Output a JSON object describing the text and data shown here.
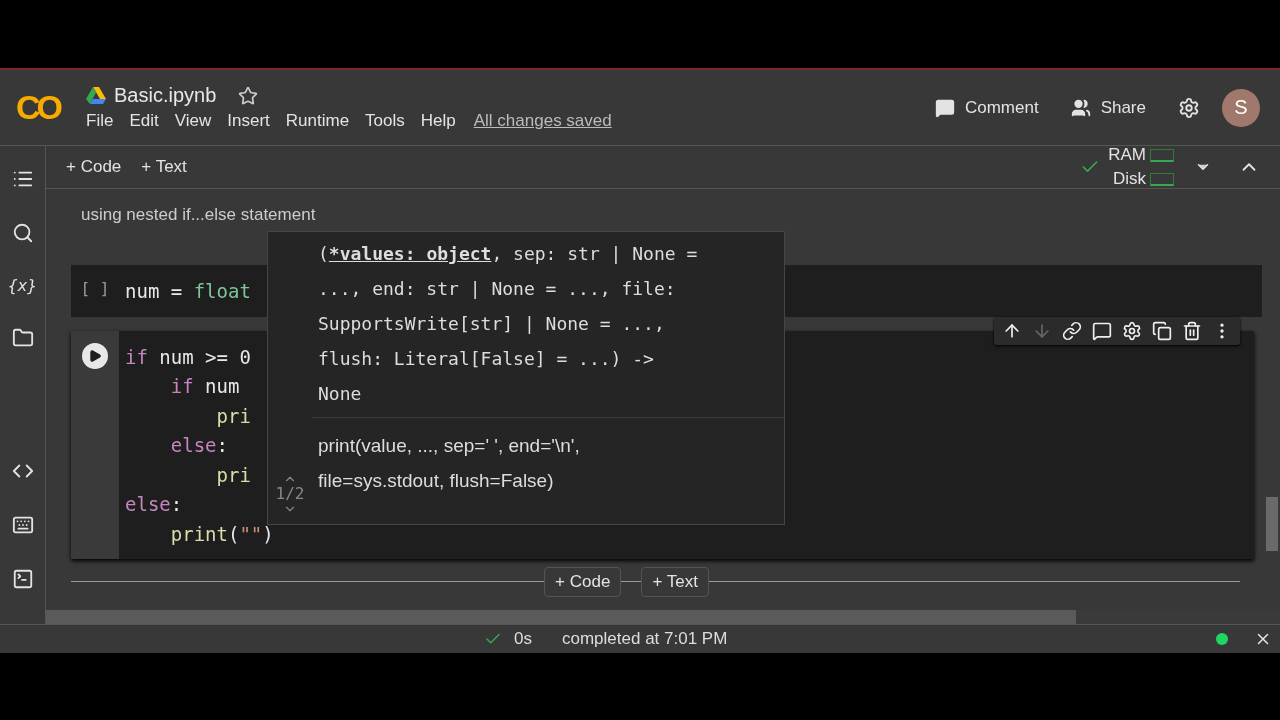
{
  "header": {
    "logo": "CO",
    "title": "Basic.ipynb",
    "starred": false,
    "menu": [
      "File",
      "Edit",
      "View",
      "Insert",
      "Runtime",
      "Tools",
      "Help"
    ],
    "save_status": "All changes saved",
    "comment": "Comment",
    "share": "Share",
    "avatar": "S"
  },
  "toolbar": {
    "add_code": "+ Code",
    "add_text": "+ Text",
    "ram": "RAM",
    "disk": "Disk",
    "connected": true
  },
  "sidebar": {
    "items": [
      {
        "kind": "toc"
      },
      {
        "kind": "search"
      },
      {
        "kind": "variables",
        "label": "{x}"
      },
      {
        "kind": "files"
      }
    ],
    "bottom": [
      {
        "kind": "code"
      },
      {
        "kind": "palette"
      },
      {
        "kind": "terminal"
      }
    ]
  },
  "cells": [
    {
      "kind": "text",
      "text": "using nested if...else statement"
    },
    {
      "kind": "code",
      "prompt": "[ ]",
      "active": false,
      "lines": [
        [
          {
            "t": "num",
            "kind": "name"
          },
          {
            "t": " = ",
            "kind": "op"
          },
          {
            "t": "float",
            "kind": "builtin"
          }
        ]
      ]
    },
    {
      "kind": "code",
      "active": true,
      "lines": [
        [
          {
            "t": "if",
            "kind": "keyword"
          },
          {
            "t": " num >= 0",
            "kind": "name"
          }
        ],
        [
          {
            "t": "    if",
            "kind": "keyword"
          },
          {
            "t": " num",
            "kind": "name"
          }
        ],
        [
          {
            "t": "        pri",
            "kind": "func"
          }
        ],
        [
          {
            "t": "    else",
            "kind": "keyword"
          },
          {
            "t": ":",
            "kind": "op"
          }
        ],
        [
          {
            "t": "        pri",
            "kind": "func"
          }
        ],
        [
          {
            "t": "else",
            "kind": "keyword"
          },
          {
            "t": ":",
            "kind": "op"
          }
        ],
        [
          {
            "t": "    print",
            "kind": "func"
          },
          {
            "t": "(",
            "kind": "op"
          },
          {
            "t": "\"\"",
            "kind": "string"
          },
          {
            "t": ")",
            "kind": "op"
          }
        ]
      ]
    }
  ],
  "tooltip": {
    "signature_lines": [
      [
        {
          "t": "(",
          "bold": false
        },
        {
          "t": "*values: object",
          "bold": true
        },
        {
          "t": ", sep: str | None =",
          "bold": false
        }
      ],
      [
        {
          "t": "..., end: str | None = ..., file:",
          "bold": false
        }
      ],
      [
        {
          "t": "SupportsWrite[str] | None = ...,",
          "bold": false
        }
      ],
      [
        {
          "t": "flush: Literal[False] = ...) ->",
          "bold": false
        }
      ],
      [
        {
          "t": "None",
          "bold": false
        }
      ]
    ],
    "doc_lines": [
      "print(value, ..., sep=' ', end='\\n',",
      "file=sys.stdout, flush=False)"
    ],
    "counter": "1/2"
  },
  "cell_toolbar": [
    {
      "kind": "up",
      "disabled": false
    },
    {
      "kind": "down",
      "disabled": true
    },
    {
      "kind": "link",
      "disabled": false
    },
    {
      "kind": "comment",
      "disabled": false
    },
    {
      "kind": "settings",
      "disabled": false
    },
    {
      "kind": "mirror",
      "disabled": false
    },
    {
      "kind": "delete",
      "disabled": false
    },
    {
      "kind": "more",
      "disabled": false
    }
  ],
  "add_cell": {
    "code": "+ Code",
    "text": "+ Text"
  },
  "status_bar": {
    "ok": true,
    "duration": "0s",
    "message": "completed at 7:01 PM",
    "connected": true
  }
}
